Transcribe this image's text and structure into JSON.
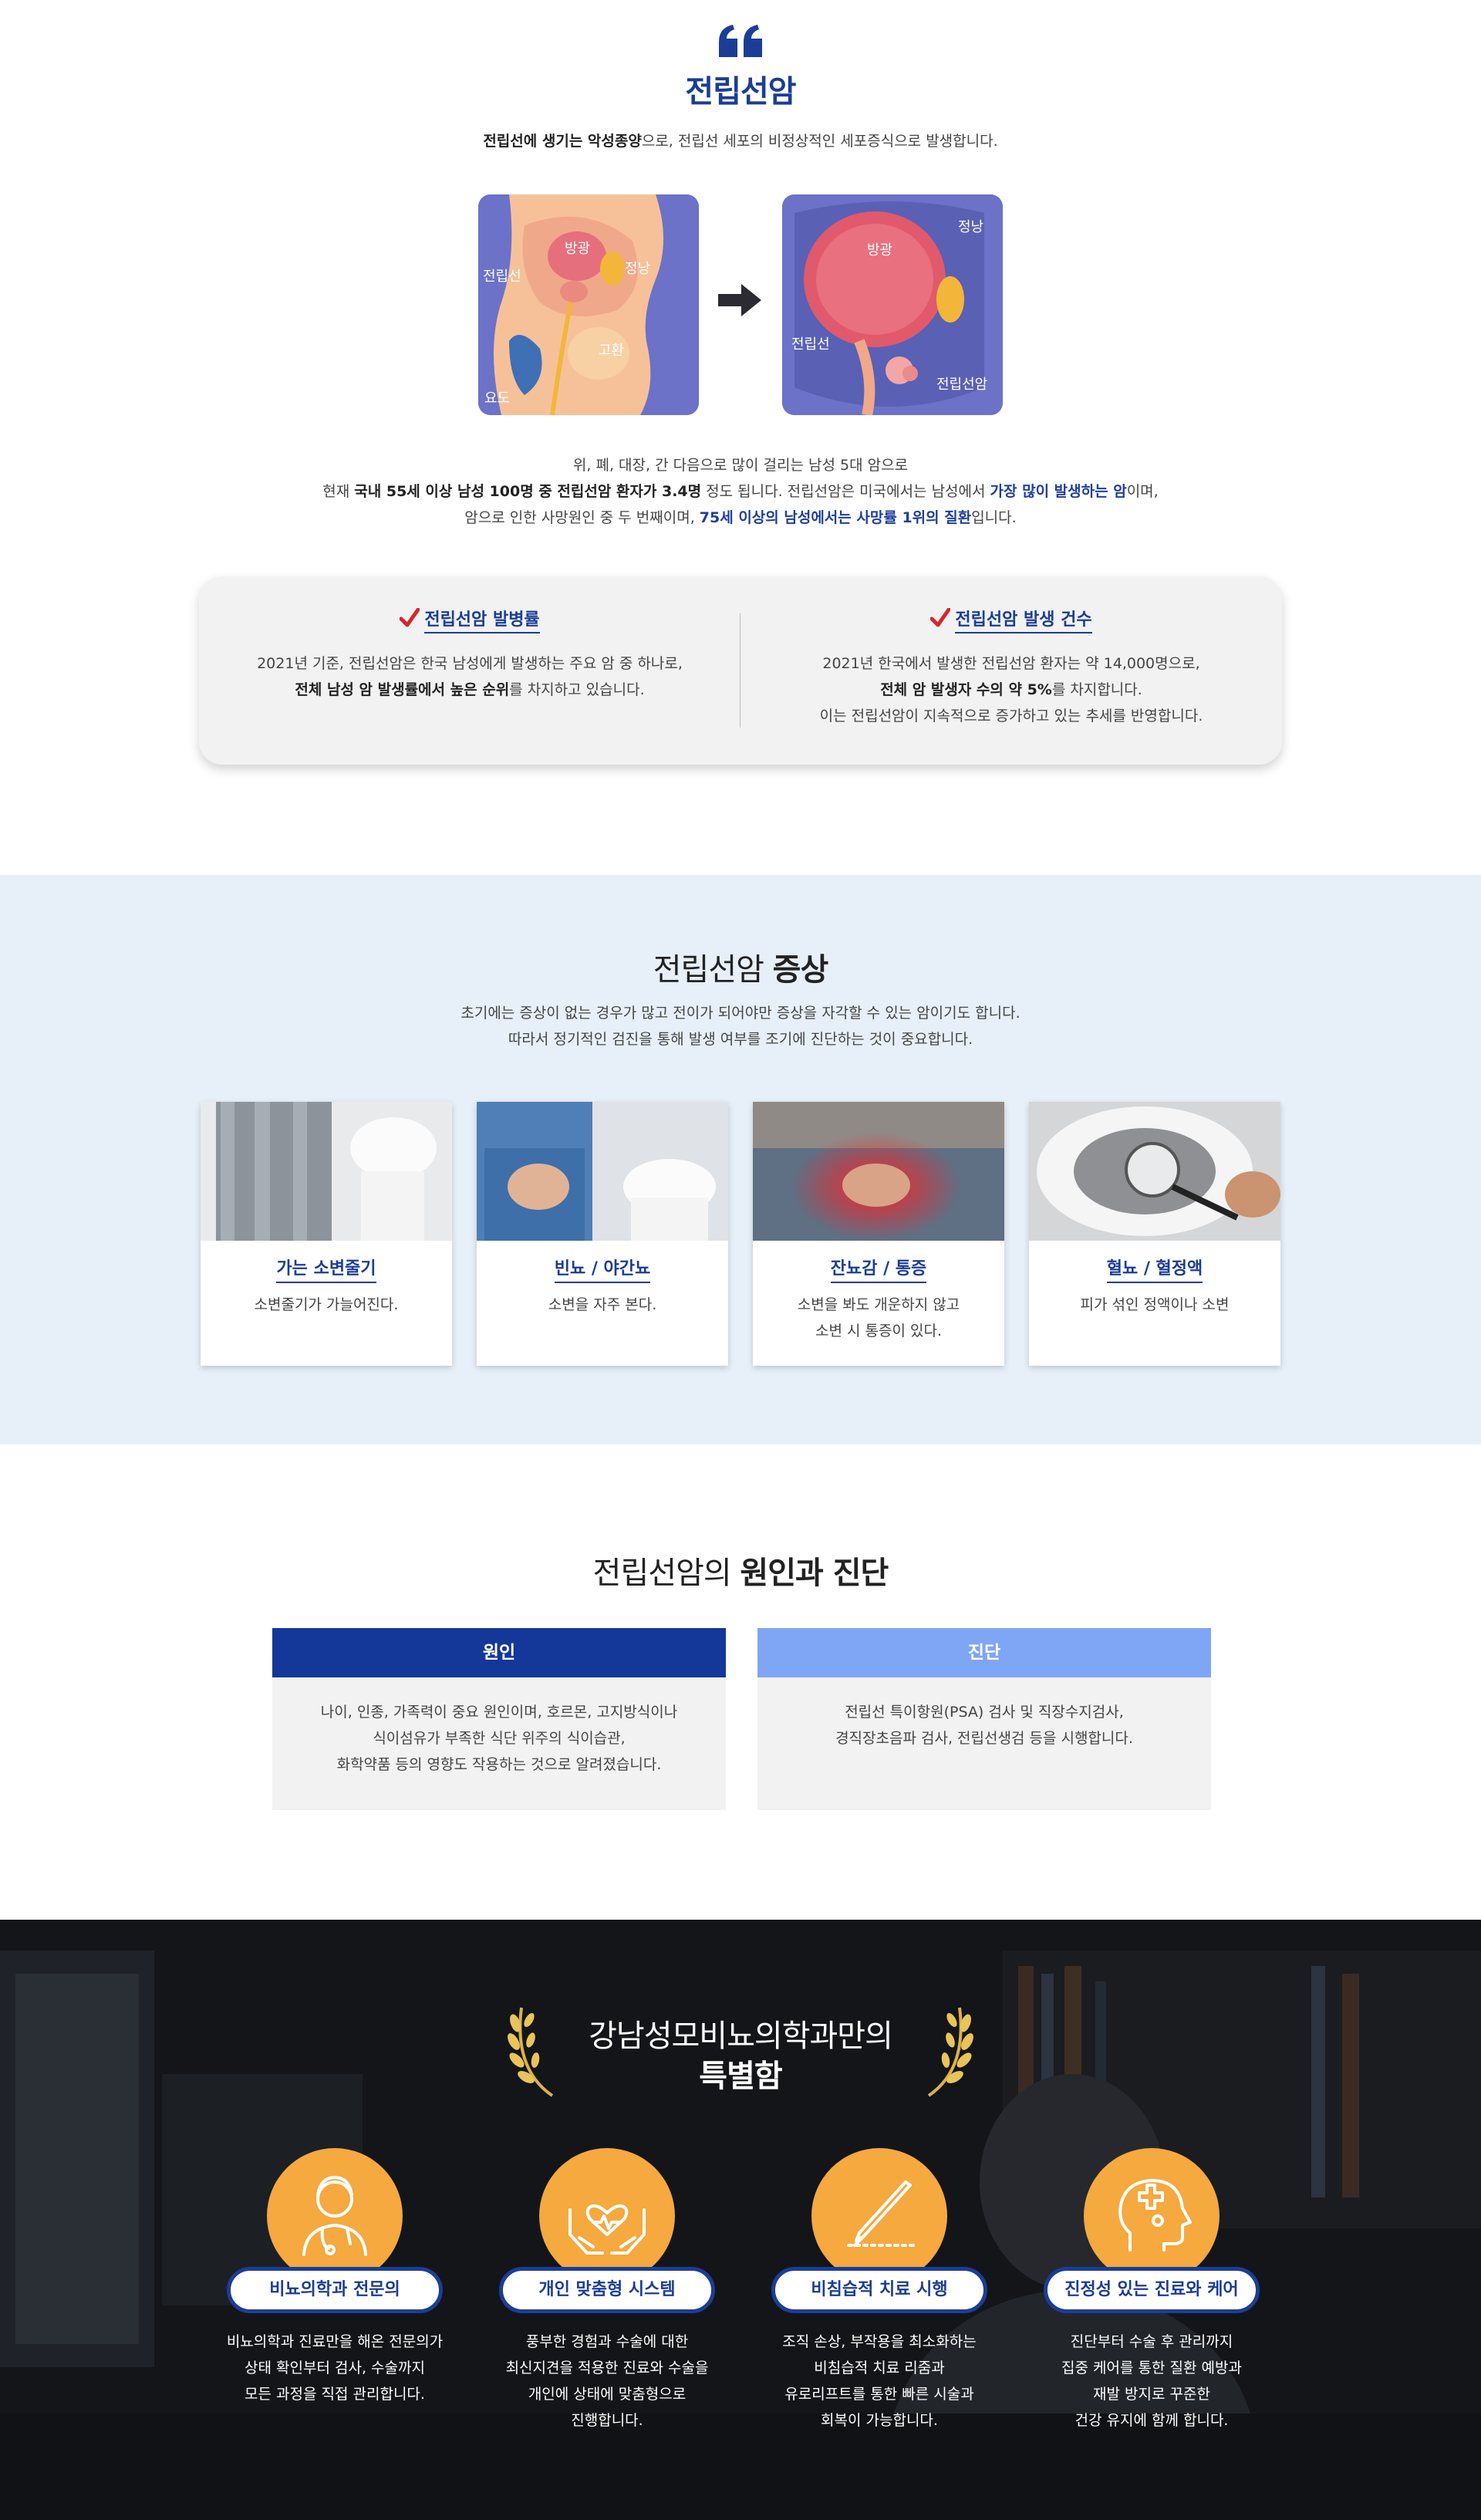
{
  "intro": {
    "title": "전립선암",
    "desc_bold": "전립선에 생기는 악성종양",
    "desc_rest": "으로, 전립선 세포의 비정상적인 세포증식으로 발생합니다.",
    "diagram_left": {
      "labels": [
        "방광",
        "정낭",
        "전립선",
        "고환",
        "요도"
      ]
    },
    "diagram_right": {
      "labels": [
        "방광",
        "정낭",
        "전립선",
        "전립선암"
      ]
    },
    "stats": {
      "line1": "위, 폐, 대장, 간 다음으로 많이 걸리는 남성 5대 암으로",
      "line2_a": "현재 ",
      "line2_b": "국내 55세 이상 남성 100명 중 전립선암 환자가 3.4명",
      "line2_c": " 정도 됩니다. 전립선암은 미국에서는 남성에서 ",
      "line2_d": "가장 많이 발생하는 암",
      "line2_e": "이며,",
      "line3_a": "암으로 인한 사망원인 중 두 번째이며, ",
      "line3_b": "75세 이상의 남성에서는 사망률 1위의 질환",
      "line3_c": "입니다."
    },
    "cards": [
      {
        "title": "전립선암 발병률",
        "line1": "2021년 기준, 전립선암은 한국 남성에게 발생하는 주요 암 중 하나로,",
        "line2_bold": "전체 남성 암 발생률에서 높은 순위",
        "line2_rest": "를 차지하고 있습니다."
      },
      {
        "title": "전립선암 발생 건수",
        "line1": "2021년 한국에서 발생한 전립선암 환자는 약 14,000명으로,",
        "line2_bold": "전체 암 발생자 수의 약 5%",
        "line2_rest": "를 차지합니다.",
        "line3": "이는 전립선암이 지속적으로 증가하고 있는 추세를 반영합니다."
      }
    ]
  },
  "symptoms": {
    "title_light": "전립선암 ",
    "title_bold": "증상",
    "desc_line1": "초기에는 증상이 없는 경우가 많고 전이가 되어야만 증상을 자각할 수 있는 암이기도 합니다.",
    "desc_line2": "따라서 정기적인 검진을 통해 발생 여부를 조기에 진단하는 것이 중요합니다.",
    "items": [
      {
        "title": "가는 소변줄기",
        "desc1": "소변줄기가 가늘어진다.",
        "desc2": ""
      },
      {
        "title": "빈뇨 / 야간뇨",
        "desc1": "소변을 자주 본다.",
        "desc2": ""
      },
      {
        "title": "잔뇨감 / 통증",
        "desc1": "소변을 봐도 개운하지 않고",
        "desc2": "소변 시 통증이 있다."
      },
      {
        "title": "혈뇨 / 혈정액",
        "desc1": "피가 섞인 정액이나 소변",
        "desc2": ""
      }
    ]
  },
  "cause_diagnosis": {
    "title_light": "전립선암의 ",
    "title_bold": "원인과 진단",
    "cause": {
      "head": "원인",
      "line1": "나이, 인종, 가족력이 중요 원인이며, 호르몬, 고지방식이나",
      "line2": "식이섬유가 부족한 식단 위주의 식이습관,",
      "line3": "화학약품 등의 영향도 작용하는 것으로 알려졌습니다."
    },
    "diagnosis": {
      "head": "진단",
      "line1": "전립선 특이항원(PSA) 검사 및 직장수지검사,",
      "line2": "경직장초음파 검사, 전립선생검 등을 시행합니다."
    },
    "colors": {
      "cause_head": "#14379a",
      "diagnosis_head": "#7fa6f5"
    }
  },
  "special": {
    "title_line1": "강남성모비뇨의학과만의",
    "title_line2": "특별함",
    "features": [
      {
        "icon": "doctor-icon",
        "label": "비뇨의학과 전문의",
        "lines": [
          "비뇨의학과 진료만을 해온 전문의가",
          "상태 확인부터 검사, 수술까지",
          "모든 과정을 직접 관리합니다.",
          ""
        ]
      },
      {
        "icon": "care-hands-icon",
        "label": "개인 맞춤형 시스템",
        "lines": [
          "풍부한 경험과 수술에 대한",
          "최신지견을 적용한 진료와 수술을",
          "개인에 상태에 맞춤형으로",
          "진행합니다."
        ]
      },
      {
        "icon": "scalpel-icon",
        "label": "비침습적 치료 시행",
        "lines": [
          "조직 손상, 부작용을 최소화하는",
          "비침습적 치료 리줌과",
          "유로리프트를 통한 빠른 시술과",
          "회복이 가능합니다."
        ]
      },
      {
        "icon": "head-medical-icon",
        "label": "진정성 있는 진료와 케어",
        "lines": [
          "진단부터 수술 후 관리까지",
          "집중 케어를 통한 질환 예방과",
          "재발 방지로 꾸준한",
          "건강 유지에 함께 합니다."
        ]
      }
    ],
    "colors": {
      "accent": "#f5a93f",
      "brand": "#1b3d96"
    }
  }
}
